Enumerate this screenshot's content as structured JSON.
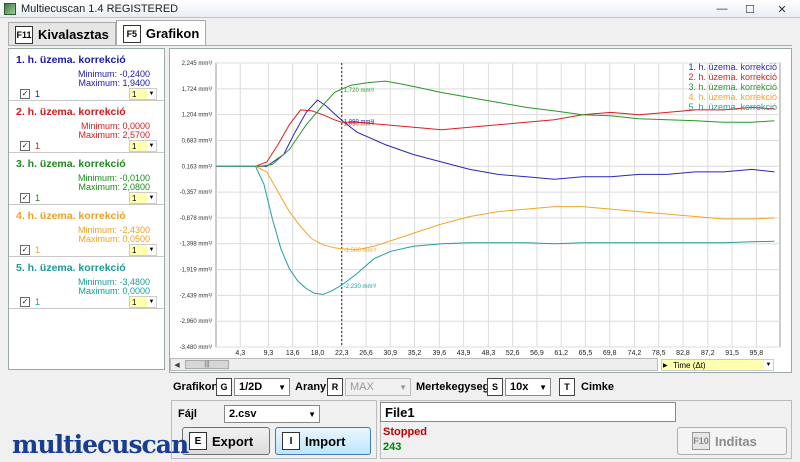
{
  "window": {
    "title": "Multiecuscan 1.4 REGISTERED",
    "minimize": "—",
    "maximize": "☐",
    "close": "✕"
  },
  "tabs": [
    {
      "key": "F11",
      "label": "Kivalasztas"
    },
    {
      "key": "F5",
      "label": "Grafikon"
    }
  ],
  "channels": [
    {
      "name": "1. h. üzema. korrekció",
      "min": "Minimum: -0,2400",
      "max": "Maximum: 1,9400",
      "checked": "✓",
      "num": "1",
      "combo": "1",
      "color": "#1a1aa8"
    },
    {
      "name": "2. h. üzema. korrekció",
      "min": "Minimum: 0,0000",
      "max": "Maximum: 2,5700",
      "checked": "✓",
      "num": "1",
      "combo": "1",
      "color": "#d21a1a"
    },
    {
      "name": "3. h. üzema. korrekció",
      "min": "Minimum: -0,0100",
      "max": "Maximum: 2,0800",
      "checked": "✓",
      "num": "1",
      "combo": "1",
      "color": "#1c8a1c"
    },
    {
      "name": "4. h. üzema. korrekció",
      "min": "Minimum: -2,4300",
      "max": "Maximum: 0,0500",
      "checked": "✓",
      "num": "1",
      "combo": "1",
      "color": "#f0a020"
    },
    {
      "name": "5. h. üzema. korrekció",
      "min": "Minimum: -3,4800",
      "max": "Maximum: 0,0000",
      "checked": "✓",
      "num": "1",
      "combo": "1",
      "color": "#1a9a9a"
    }
  ],
  "chart_data": {
    "type": "line",
    "unit": "mm³/",
    "y_ticks": [
      "2,245 mm³/",
      "1,724 mm³/",
      "1,204 mm³/",
      "0,683 mm³/",
      "0,163 mm³/",
      "-0,357 mm³/",
      "-0,878 mm³/",
      "-1,398 mm³/",
      "-1,919 mm³/",
      "-2,439 mm³/",
      "-2,960 mm³/",
      "-3,480 mm³/"
    ],
    "y_values": [
      2.245,
      1.724,
      1.204,
      0.683,
      0.163,
      -0.357,
      -0.878,
      -1.398,
      -1.919,
      -2.439,
      -2.96,
      -3.48
    ],
    "x_ticks": [
      "4,3",
      "9,3",
      "13,6",
      "18,0",
      "22,3",
      "26,6",
      "30,9",
      "35,2",
      "39,6",
      "43,9",
      "48,3",
      "52,6",
      "56,9",
      "61,2",
      "65,5",
      "69,8",
      "74,2",
      "78,5",
      "82,8",
      "87,2",
      "91,5",
      "95,8"
    ],
    "x_tick_values": [
      4.3,
      9.3,
      13.6,
      18.0,
      22.3,
      26.6,
      30.9,
      35.2,
      39.6,
      43.9,
      48.3,
      52.6,
      56.9,
      61.2,
      65.5,
      69.8,
      74.2,
      78.5,
      82.8,
      87.2,
      91.5,
      95.8
    ],
    "xlim": [
      0,
      100
    ],
    "ylim": [
      -3.48,
      2.245
    ],
    "cursor_x": 22.3,
    "series": [
      {
        "name": "1. h. üzema. korrekció",
        "color": "#2828b4",
        "x": [
          0,
          6,
          9,
          12,
          14,
          16,
          18,
          19.5,
          21,
          22.3,
          25,
          30,
          35,
          40,
          45,
          50,
          55,
          60,
          65,
          70,
          75,
          80,
          85,
          90,
          95,
          99
        ],
        "y": [
          0.163,
          0.163,
          0.163,
          0.4,
          0.85,
          1.25,
          1.5,
          1.38,
          1.22,
          1.09,
          0.85,
          0.6,
          0.4,
          0.25,
          0.1,
          0.0,
          -0.05,
          -0.1,
          -0.05,
          -0.05,
          0.0,
          0.0,
          0.05,
          0.05,
          0.1,
          0.05
        ]
      },
      {
        "name": "2. h. üzema. korrekció",
        "color": "#d82020",
        "x": [
          0,
          7,
          9,
          11,
          13,
          15,
          17,
          19,
          21,
          22.3,
          25,
          30,
          35,
          40,
          45,
          50,
          55,
          60,
          65,
          70,
          75,
          80,
          85,
          90,
          95,
          99
        ],
        "y": [
          0.163,
          0.163,
          0.25,
          0.6,
          1.0,
          1.3,
          1.28,
          1.2,
          1.1,
          1.05,
          1.05,
          1.0,
          0.95,
          0.9,
          0.95,
          1.0,
          1.05,
          1.1,
          1.2,
          1.25,
          1.2,
          1.25,
          1.3,
          1.3,
          1.35,
          1.32
        ]
      },
      {
        "name": "3. h. üzema. korrekció",
        "color": "#2a962a",
        "x": [
          0,
          8,
          10,
          13,
          16,
          19,
          21,
          22.3,
          24,
          27,
          30,
          33,
          36,
          40,
          45,
          50,
          55,
          60,
          65,
          70,
          75,
          80,
          85,
          90,
          95,
          99
        ],
        "y": [
          0.163,
          0.163,
          0.2,
          0.5,
          1.0,
          1.4,
          1.65,
          1.72,
          1.8,
          1.85,
          1.88,
          1.82,
          1.75,
          1.65,
          1.55,
          1.45,
          1.35,
          1.28,
          1.2,
          1.18,
          1.12,
          1.1,
          1.08,
          1.05,
          1.05,
          1.08
        ]
      },
      {
        "name": "4. h. üzema. korrekció",
        "color": "#f2a52a",
        "x": [
          0,
          7,
          9,
          11,
          13,
          15,
          17,
          19,
          21,
          22.3,
          25,
          28,
          32,
          36,
          40,
          45,
          50,
          55,
          60,
          65,
          70,
          75,
          80,
          85,
          90,
          95,
          99
        ],
        "y": [
          0.163,
          0.163,
          0.05,
          -0.35,
          -0.75,
          -1.05,
          -1.3,
          -1.42,
          -1.48,
          -1.5,
          -1.52,
          -1.45,
          -1.3,
          -1.15,
          -1.0,
          -0.85,
          -0.75,
          -0.7,
          -0.65,
          -0.65,
          -0.7,
          -0.75,
          -0.8,
          -0.85,
          -0.9,
          -0.9,
          -0.88
        ]
      },
      {
        "name": "5. h. üzema. korrekció",
        "color": "#239e9e",
        "x": [
          0,
          7,
          8.5,
          10,
          11.5,
          13,
          14.5,
          16,
          17.5,
          19,
          20.5,
          22.3,
          25,
          28,
          31,
          35,
          40,
          45,
          50,
          55,
          60,
          65,
          70,
          75,
          80,
          85,
          90,
          95,
          99
        ],
        "y": [
          0.163,
          0.163,
          -0.2,
          -0.9,
          -1.5,
          -1.9,
          -2.15,
          -2.3,
          -2.4,
          -2.42,
          -2.35,
          -2.23,
          -2.0,
          -1.7,
          -1.55,
          -1.45,
          -1.4,
          -1.38,
          -1.38,
          -1.38,
          -1.4,
          -1.38,
          -1.38,
          -1.38,
          -1.38,
          -1.38,
          -1.38,
          -1.36,
          -1.35
        ]
      }
    ],
    "annotations": [
      {
        "text": "1,720 mm³/",
        "x": 22.3,
        "y": 1.72,
        "color": "#2a962a"
      },
      {
        "text": "1,090 mm³/",
        "x": 22.3,
        "y": 1.09,
        "color": "#2828b4"
      },
      {
        "text": "1,050 mm³/",
        "x": 22.3,
        "y": 1.05,
        "color": "#d82020"
      },
      {
        "text": "-1,500 mm³/",
        "x": 22.3,
        "y": -1.5,
        "color": "#f2a52a"
      },
      {
        "text": "-2,230 mm³/",
        "x": 22.3,
        "y": -2.23,
        "color": "#239e9e"
      }
    ],
    "legend_position": "top-right"
  },
  "scroll": {
    "thumb": "|||",
    "left_arrow": "◀"
  },
  "time_combo": {
    "label": "Time (Δt)",
    "arrow": "▶",
    "drop": "▼"
  },
  "controls": {
    "grafikon_label": "Grafikon",
    "grafikon_key": "G",
    "grafikon_value": "1/2D",
    "arany_label": "Arany",
    "arany_key": "R",
    "arany_value": "MAX",
    "mertek_label": "Mertekegyseg",
    "mertek_key": "S",
    "mertek_value": "10x",
    "cimke_key": "T",
    "cimke_label": "Cimke",
    "dropdown": "▼"
  },
  "file": {
    "label": "Fájl",
    "value": "2.csv",
    "export_key": "E",
    "export_label": "Export",
    "import_key": "I",
    "import_label": "Import"
  },
  "status": {
    "file_name": "File1",
    "state": "Stopped",
    "count": "243",
    "start_key": "F10",
    "start_label": "Inditas"
  },
  "logo": "multiecuscan"
}
